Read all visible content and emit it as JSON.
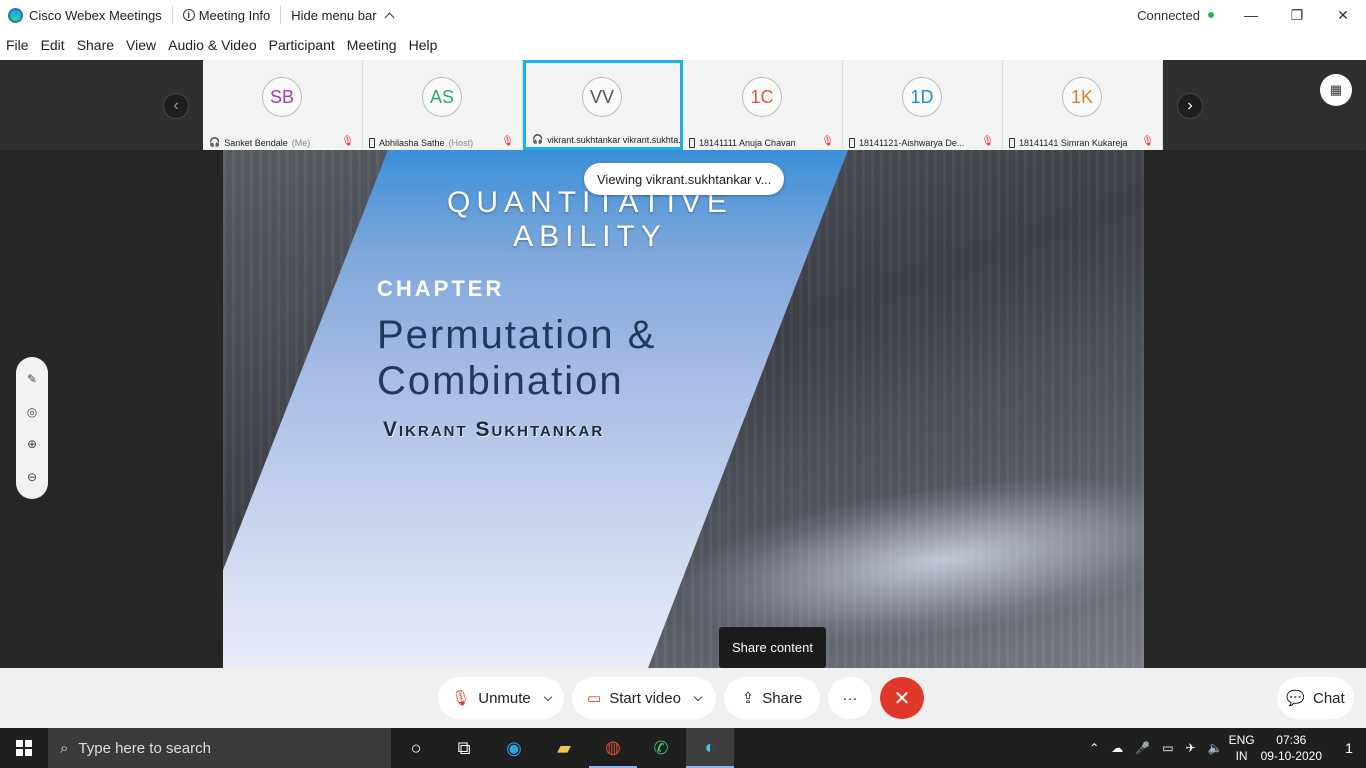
{
  "titlebar": {
    "app_name": "Cisco Webex Meetings",
    "meeting_info": "Meeting Info",
    "hide_menu": "Hide menu bar",
    "status": "Connected",
    "minimize": "—",
    "restore": "❐",
    "close": "✕"
  },
  "menu": [
    "File",
    "Edit",
    "Share",
    "View",
    "Audio & Video",
    "Participant",
    "Meeting",
    "Help"
  ],
  "participants": [
    {
      "initials": "SB",
      "name": "Sanket Bendale",
      "role": "(Me)",
      "color": "#a13bb0"
    },
    {
      "initials": "AS",
      "name": "Abhilasha Sathe",
      "role": "(Host)",
      "color": "#2ca86a"
    },
    {
      "initials": "VV",
      "name": "vikrant.sukhtankar vikrant.sukhta...",
      "role": "",
      "color": "#555555"
    },
    {
      "initials": "1C",
      "name": "18141111 Anuja Chavan",
      "role": "",
      "color": "#e0553b"
    },
    {
      "initials": "1D",
      "name": "18141121-Aishwarya De...",
      "role": "",
      "color": "#1a8fd6"
    },
    {
      "initials": "1K",
      "name": "18141141 Simran Kukareja",
      "role": "",
      "color": "#e07b2b"
    }
  ],
  "strip": {
    "prev": "‹",
    "next": "›",
    "calendar_icon": "▦"
  },
  "slide": {
    "title_line1": "QUANTITATIVE",
    "title_line2": "ABILITY",
    "chapter": "CHAPTER",
    "topic_line1": "Permutation &",
    "topic_line2": "Combination",
    "author": "Vikrant Sukhtankar"
  },
  "viewing_banner": "Viewing vikrant.sukhtankar v...",
  "tooltip": "Share content",
  "side_tools": [
    "✎",
    "◎",
    "⊕",
    "⊖"
  ],
  "controls": {
    "unmute": "Unmute",
    "start_video": "Start video",
    "share": "Share",
    "more": "···",
    "end": "✕",
    "chat": "Chat"
  },
  "taskbar": {
    "search_placeholder": "Type here to search",
    "lang_top": "ENG",
    "lang_bottom": "IN",
    "time": "07:36",
    "date": "09-10-2020",
    "notif_count": "1"
  }
}
